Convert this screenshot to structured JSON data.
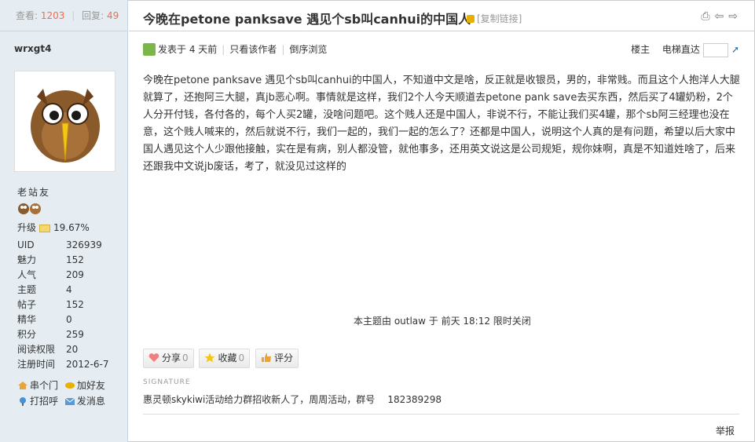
{
  "sidebar": {
    "views_label": "查看:",
    "views": "1203",
    "replies_label": "回复:",
    "replies": "49",
    "username": "wrxgt4",
    "rank": "老站友",
    "upgrade_label": "升级",
    "upgrade_value": "19.67%",
    "info": [
      {
        "key": "UID",
        "value": "326939"
      },
      {
        "key": "魅力",
        "value": "152"
      },
      {
        "key": "人气",
        "value": "209"
      },
      {
        "key": "主题",
        "value": "4"
      },
      {
        "key": "帖子",
        "value": "152"
      },
      {
        "key": "精华",
        "value": "0"
      },
      {
        "key": "积分",
        "value": "259"
      },
      {
        "key": "阅读权限",
        "value": "20"
      },
      {
        "key": "注册时间",
        "value": "2012-6-7"
      }
    ],
    "actions": {
      "visit": "串个门",
      "add_friend": "加好友",
      "greet": "打招呼",
      "message": "发消息"
    }
  },
  "post": {
    "title": "今晚在petone panksave 遇见个sb叫canhui的中国人",
    "copy_link": "[复制链接]",
    "posted": "发表于 4 天前",
    "only_author": "只看该作者",
    "reverse": "倒序浏览",
    "floor": "楼主",
    "elevator": "电梯直达",
    "body": "今晚在petone panksave 遇见个sb叫canhui的中国人，不知道中文是啥，反正就是收银员，男的，非常贱。而且这个人抱洋人大腿就算了，还抱阿三大腿，真jb恶心啊。事情就是这样，我们2个人今天顺道去petone pank save去买东西，然后买了4罐奶粉，2个人分开付钱，各付各的，每个人买2罐，没啥问题吧。这个贱人还是中国人，非说不行，不能让我们买4罐，那个sb阿三经理也没在意，这个贱人喊来的，然后就说不行，我们一起的，我们一起的怎么了？还都是中国人，说明这个人真的是有问题，希望以后大家中国人遇见这个人少跟他接触，实在是有病，别人都没管，就他事多，还用英文说这是公司规矩，规你妹啊，真是不知道姓啥了，后来还跟我中文说jb废话，考了，就没见过这样的",
    "closed_notice": "本主题由 outlaw 于 前天 18:12 限时关闭",
    "share_label": "分享",
    "share_count": "0",
    "fav_label": "收藏",
    "fav_count": "0",
    "rate_label": "评分",
    "signature_label": "SIGNATURE",
    "signature_text": "惠灵顿skykiwi活动给力群招收新人了，周周活动，群号",
    "signature_number": "182389298",
    "report": "举报"
  },
  "colors": {
    "accent": "#f26c4f",
    "sidebar_bg": "#e5edf2",
    "border": "#c2d5e3"
  }
}
